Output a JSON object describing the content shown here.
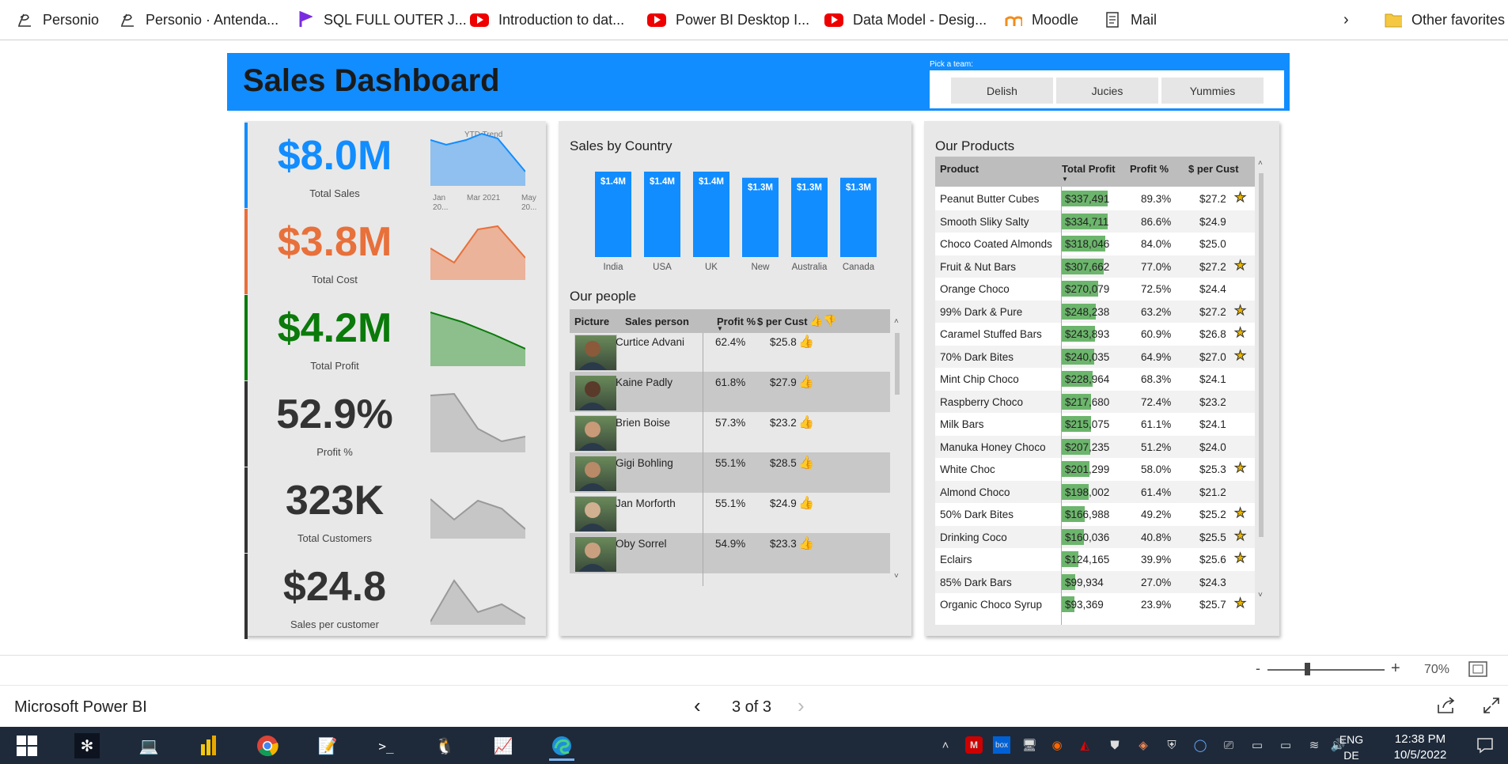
{
  "favorites": [
    {
      "label": "Personio",
      "icon": "personio-icon"
    },
    {
      "label": "Personio · Antenda...",
      "icon": "personio-icon"
    },
    {
      "label": "SQL FULL OUTER J...",
      "icon": "bookmark-logo-icon"
    },
    {
      "label": "Introduction to dat...",
      "icon": "youtube-icon"
    },
    {
      "label": "Power BI Desktop I...",
      "icon": "youtube-icon"
    },
    {
      "label": "Data Model - Desig...",
      "icon": "youtube-icon"
    },
    {
      "label": "Moodle",
      "icon": "moodle-icon"
    },
    {
      "label": "Mail",
      "icon": "document-icon"
    }
  ],
  "other_favorites": "Other favorites",
  "dashboard": {
    "title": "Sales Dashboard",
    "team_label": "Pick a team:",
    "teams": [
      "Delish",
      "Jucies",
      "Yummies"
    ],
    "trend_label": "YTD Trend",
    "trend_axis": [
      "Jan 20...",
      "Mar 2021",
      "May 20..."
    ],
    "kpis": [
      {
        "value": "$8.0M",
        "label": "Total Sales",
        "color": "#118dff"
      },
      {
        "value": "$3.8M",
        "label": "Total Cost",
        "color": "#e8703a"
      },
      {
        "value": "$4.2M",
        "label": "Total Profit",
        "color": "#0a7a0a"
      },
      {
        "value": "52.9%",
        "label": "Profit %",
        "color": "#333333"
      },
      {
        "value": "323K",
        "label": "Total Customers",
        "color": "#333333"
      },
      {
        "value": "$24.8",
        "label": "Sales per customer",
        "color": "#333333"
      }
    ],
    "sales_by_country": {
      "title": "Sales by Country",
      "chart_data": {
        "type": "bar",
        "categories": [
          "India",
          "USA",
          "UK",
          "New Zealand",
          "Australia",
          "Canada"
        ],
        "values": [
          1.4,
          1.4,
          1.4,
          1.3,
          1.3,
          1.3
        ],
        "data_labels": [
          "$1.4M",
          "$1.4M",
          "$1.4M",
          "$1.3M",
          "$1.3M",
          "$1.3M"
        ],
        "color": "#118dff"
      }
    },
    "people": {
      "title": "Our people",
      "headers": [
        "Picture",
        "Sales person",
        "Profit %",
        "$ per Cust"
      ],
      "rows": [
        {
          "name": "Curtice Advani",
          "profit": "62.4%",
          "per_cust": "$25.8"
        },
        {
          "name": "Kaine Padly",
          "profit": "61.8%",
          "per_cust": "$27.9"
        },
        {
          "name": "Brien Boise",
          "profit": "57.3%",
          "per_cust": "$23.2"
        },
        {
          "name": "Gigi Bohling",
          "profit": "55.1%",
          "per_cust": "$28.5"
        },
        {
          "name": "Jan Morforth",
          "profit": "55.1%",
          "per_cust": "$24.9"
        },
        {
          "name": "Oby Sorrel",
          "profit": "54.9%",
          "per_cust": "$23.3"
        }
      ]
    },
    "products": {
      "title": "Our Products",
      "headers": [
        "Product",
        "Total Profit",
        "Profit %",
        "$ per Cust"
      ],
      "rows": [
        {
          "name": "Peanut Butter Cubes",
          "profit": "$337,491",
          "pct": "89.3%",
          "per_cust": "$27.2",
          "star": true,
          "v": 337491
        },
        {
          "name": "Smooth Sliky Salty",
          "profit": "$334,711",
          "pct": "86.6%",
          "per_cust": "$24.9",
          "star": false,
          "v": 334711
        },
        {
          "name": "Choco Coated Almonds",
          "profit": "$318,046",
          "pct": "84.0%",
          "per_cust": "$25.0",
          "star": false,
          "v": 318046
        },
        {
          "name": "Fruit & Nut Bars",
          "profit": "$307,662",
          "pct": "77.0%",
          "per_cust": "$27.2",
          "star": true,
          "v": 307662
        },
        {
          "name": "Orange Choco",
          "profit": "$270,079",
          "pct": "72.5%",
          "per_cust": "$24.4",
          "star": false,
          "v": 270079
        },
        {
          "name": "99% Dark & Pure",
          "profit": "$248,238",
          "pct": "63.2%",
          "per_cust": "$27.2",
          "star": true,
          "v": 248238
        },
        {
          "name": "Caramel Stuffed Bars",
          "profit": "$243,893",
          "pct": "60.9%",
          "per_cust": "$26.8",
          "star": true,
          "v": 243893
        },
        {
          "name": "70% Dark Bites",
          "profit": "$240,035",
          "pct": "64.9%",
          "per_cust": "$27.0",
          "star": true,
          "v": 240035
        },
        {
          "name": "Mint Chip Choco",
          "profit": "$228,964",
          "pct": "68.3%",
          "per_cust": "$24.1",
          "star": false,
          "v": 228964
        },
        {
          "name": "Raspberry Choco",
          "profit": "$217,680",
          "pct": "72.4%",
          "per_cust": "$23.2",
          "star": false,
          "v": 217680
        },
        {
          "name": "Milk Bars",
          "profit": "$215,075",
          "pct": "61.1%",
          "per_cust": "$24.1",
          "star": false,
          "v": 215075
        },
        {
          "name": "Manuka Honey Choco",
          "profit": "$207,235",
          "pct": "51.2%",
          "per_cust": "$24.0",
          "star": false,
          "v": 207235
        },
        {
          "name": "White Choc",
          "profit": "$201,299",
          "pct": "58.0%",
          "per_cust": "$25.3",
          "star": true,
          "v": 201299
        },
        {
          "name": "Almond Choco",
          "profit": "$198,002",
          "pct": "61.4%",
          "per_cust": "$21.2",
          "star": false,
          "v": 198002
        },
        {
          "name": "50% Dark Bites",
          "profit": "$166,988",
          "pct": "49.2%",
          "per_cust": "$25.2",
          "star": true,
          "v": 166988
        },
        {
          "name": "Drinking Coco",
          "profit": "$160,036",
          "pct": "40.8%",
          "per_cust": "$25.5",
          "star": true,
          "v": 160036
        },
        {
          "name": "Eclairs",
          "profit": "$124,165",
          "pct": "39.9%",
          "per_cust": "$25.6",
          "star": true,
          "v": 124165
        },
        {
          "name": "85% Dark Bars",
          "profit": "$99,934",
          "pct": "27.0%",
          "per_cust": "$24.3",
          "star": false,
          "v": 99934
        },
        {
          "name": "Organic Choco Syrup",
          "profit": "$93,369",
          "pct": "23.9%",
          "per_cust": "$25.7",
          "star": true,
          "v": 93369
        }
      ]
    }
  },
  "zoom": {
    "minus": "-",
    "plus": "+",
    "level": "70%"
  },
  "pbi": {
    "app_name": "Microsoft Power BI",
    "page": "3 of 3"
  },
  "taskbar": {
    "lang1": "ENG",
    "lang2": "DE",
    "time": "12:38 PM",
    "date": "10/5/2022"
  }
}
